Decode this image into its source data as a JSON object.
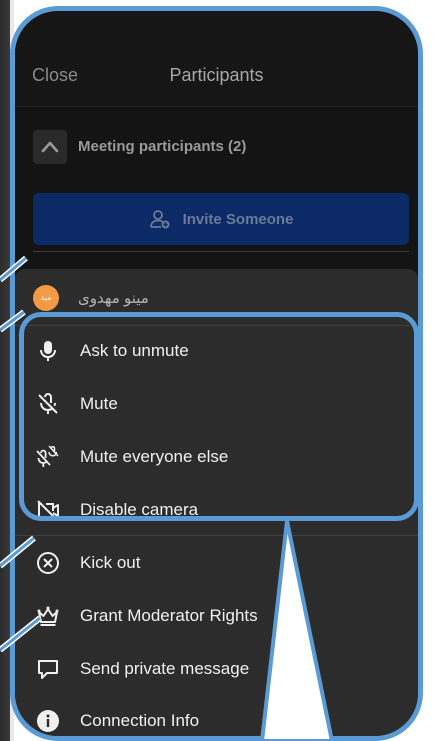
{
  "header": {
    "close_label": "Close",
    "title": "Participants"
  },
  "section": {
    "label": "Meeting participants (2)"
  },
  "invite": {
    "label": "Invite Someone"
  },
  "user": {
    "name": "مینو مهدوی",
    "avatar_text": "ميد"
  },
  "menu": {
    "items": [
      {
        "label": "Ask to unmute",
        "icon": "microphone-icon"
      },
      {
        "label": "Mute",
        "icon": "mic-off-icon"
      },
      {
        "label": "Mute everyone else",
        "icon": "mic-off-all-icon"
      },
      {
        "label": "Disable camera",
        "icon": "camera-off-icon"
      },
      {
        "label": "Kick out",
        "icon": "close-circle-icon"
      },
      {
        "label": "Grant Moderator Rights",
        "icon": "crown-icon"
      },
      {
        "label": "Send private message",
        "icon": "chat-bubble-icon"
      },
      {
        "label": "Connection Info",
        "icon": "info-icon"
      }
    ]
  },
  "colors": {
    "highlight": "#5b9bd5",
    "invite_bg": "#0b2a66",
    "avatar": "#f39a45",
    "sheet_bg": "#2c2c2c"
  }
}
